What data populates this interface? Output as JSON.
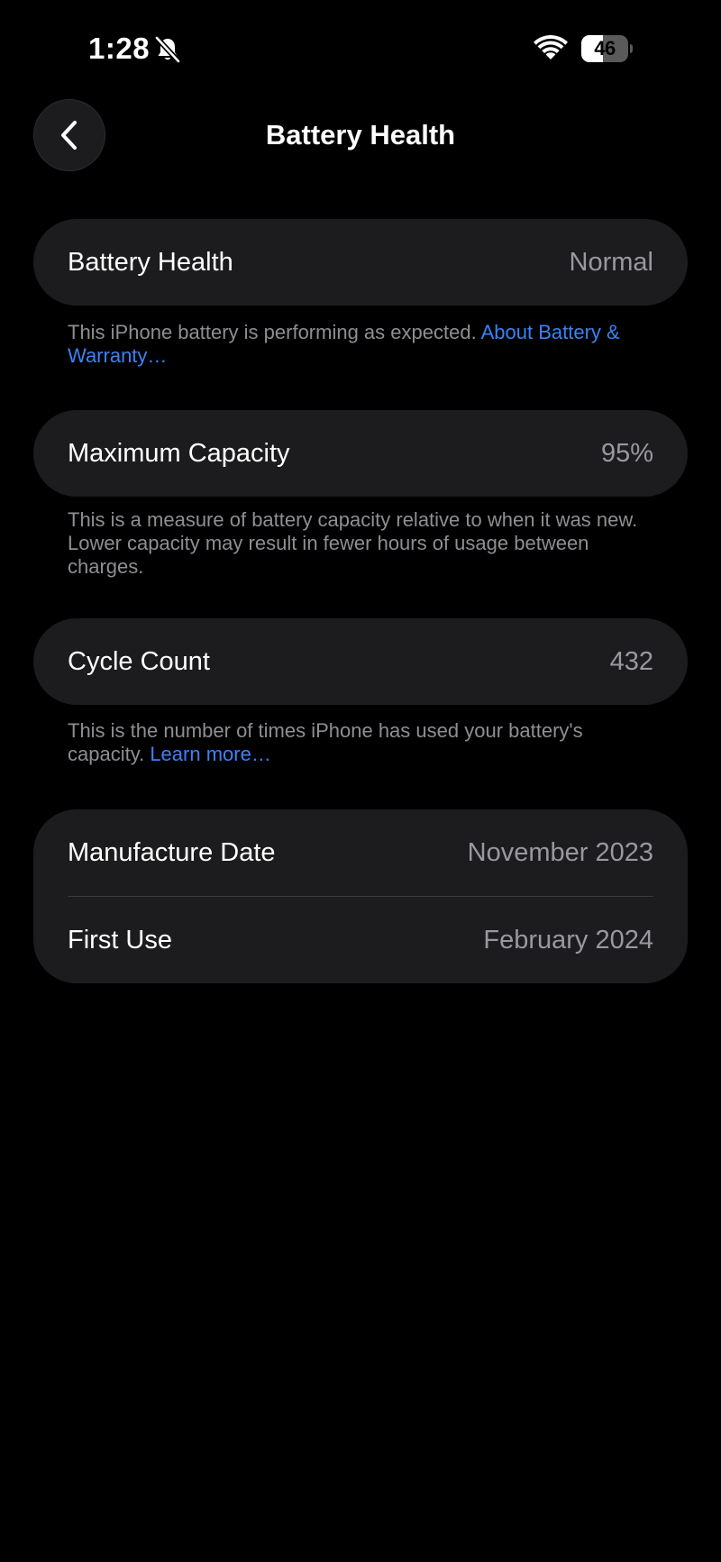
{
  "status_bar": {
    "time": "1:28",
    "battery_level": "46",
    "battery_fraction": 0.46
  },
  "icons": {
    "silent": "bell-slash-icon",
    "wifi": "wifi-icon",
    "battery": "battery-icon",
    "back": "chevron-left-icon"
  },
  "header": {
    "title": "Battery Health"
  },
  "sections": {
    "health": {
      "label": "Battery Health",
      "value": "Normal",
      "footnote": "This iPhone battery is performing as expected.",
      "link": "About Battery & Warranty…"
    },
    "capacity": {
      "label": "Maximum Capacity",
      "value": "95%",
      "footnote": "This is a measure of battery capacity relative to when it was new. Lower capacity may result in fewer hours of usage between charges."
    },
    "cycles": {
      "label": "Cycle Count",
      "value": "432",
      "footnote": "This is the number of times iPhone has used your battery's capacity.",
      "link": "Learn more…"
    },
    "dates": {
      "manufacture_label": "Manufacture Date",
      "manufacture_value": "November 2023",
      "first_use_label": "First Use",
      "first_use_value": "February 2024"
    }
  },
  "colors": {
    "background": "#000000",
    "card": "#1c1c1e",
    "secondary_text": "#98989f",
    "link": "#3b82f6"
  }
}
